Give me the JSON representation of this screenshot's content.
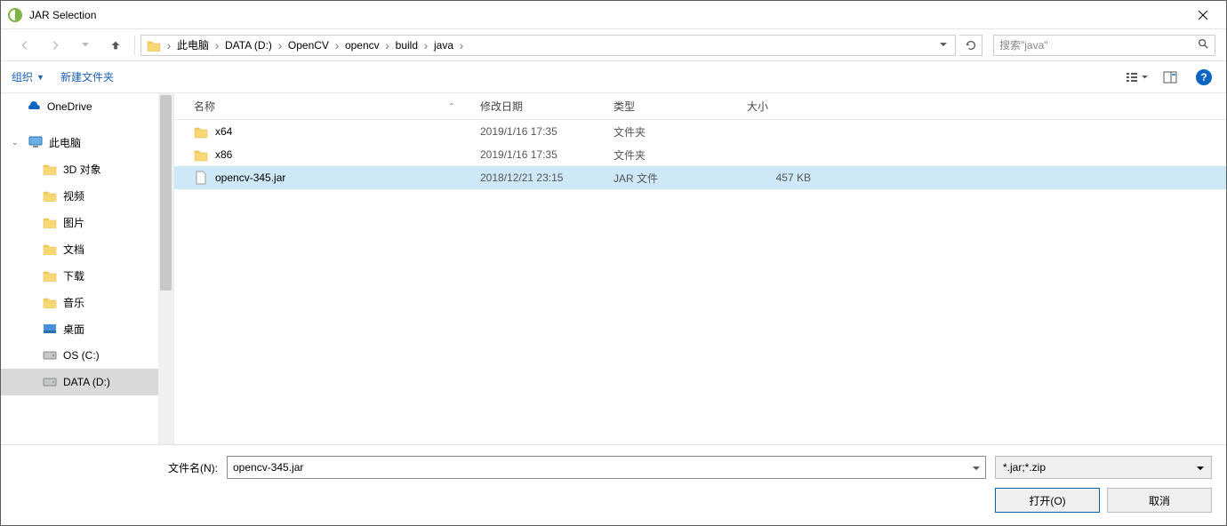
{
  "title": "JAR Selection",
  "breadcrumb": [
    "此电脑",
    "DATA (D:)",
    "OpenCV",
    "opencv",
    "build",
    "java"
  ],
  "search_placeholder": "搜索\"java\"",
  "toolbar": {
    "organize": "组织",
    "new_folder": "新建文件夹"
  },
  "columns": {
    "name": "名称",
    "date": "修改日期",
    "type": "类型",
    "size": "大小"
  },
  "sidebar": {
    "onedrive": "OneDrive",
    "thispc": "此电脑",
    "children": [
      "3D 对象",
      "视频",
      "图片",
      "文档",
      "下载",
      "音乐",
      "桌面",
      "OS (C:)",
      "DATA (D:)"
    ]
  },
  "files": [
    {
      "name": "x64",
      "date": "2019/1/16 17:35",
      "type": "文件夹",
      "size": "",
      "kind": "folder"
    },
    {
      "name": "x86",
      "date": "2019/1/16 17:35",
      "type": "文件夹",
      "size": "",
      "kind": "folder"
    },
    {
      "name": "opencv-345.jar",
      "date": "2018/12/21 23:15",
      "type": "JAR 文件",
      "size": "457 KB",
      "kind": "file",
      "selected": true
    }
  ],
  "footer": {
    "filename_label": "文件名(N):",
    "filename_value": "opencv-345.jar",
    "filter": "*.jar;*.zip",
    "open": "打开(O)",
    "cancel": "取消"
  }
}
